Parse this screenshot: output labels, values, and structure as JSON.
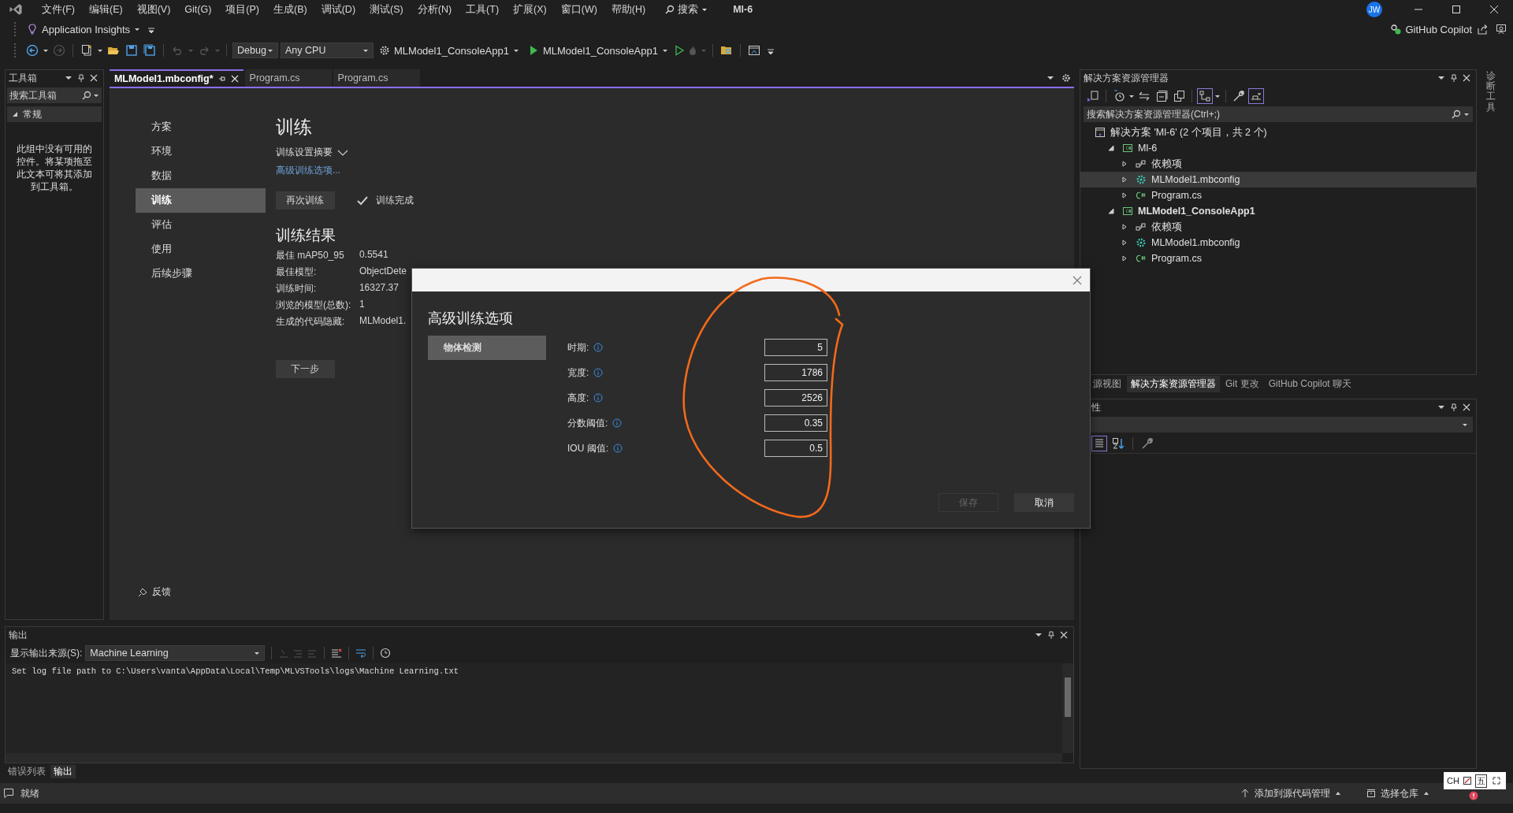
{
  "menu_bar": {
    "items": [
      "文件(F)",
      "编辑(E)",
      "视图(V)",
      "Git(G)",
      "项目(P)",
      "生成(B)",
      "调试(D)",
      "测试(S)",
      "分析(N)",
      "工具(T)",
      "扩展(X)",
      "窗口(W)",
      "帮助(H)"
    ],
    "search": "搜索",
    "solution_name": "Ml-6",
    "avatar": "JW"
  },
  "toolbar": {
    "insights": "Application Insights",
    "configuration": "Debug",
    "platform": "Any CPU",
    "startup_project": "MLModel1_ConsoleApp1",
    "run_target": "MLModel1_ConsoleApp1",
    "copilot": "GitHub Copilot"
  },
  "toolbox": {
    "title": "工具箱",
    "search_placeholder": "搜索工具箱",
    "group": {
      "label": "常规",
      "expanded": true
    },
    "empty_text": "此组中没有可用的控件。将某项拖至此文本可将其添加到工具箱。"
  },
  "editor_tabs": [
    {
      "label": "MLModel1.mbconfig*",
      "selected": true
    },
    {
      "label": "Program.cs",
      "selected": false
    },
    {
      "label": "Program.cs",
      "selected": false
    }
  ],
  "model_builder": {
    "nav": [
      {
        "label": "方案",
        "selected": false
      },
      {
        "label": "环境",
        "selected": false
      },
      {
        "label": "数据",
        "selected": false
      },
      {
        "label": "训练",
        "selected": true
      },
      {
        "label": "评估",
        "selected": false
      },
      {
        "label": "使用",
        "selected": false
      },
      {
        "label": "后续步骤",
        "selected": false
      }
    ],
    "title": "训练",
    "summary_toggle": "训练设置摘要",
    "advanced_link": "高级训练选项...",
    "retrain_button": "再次训练",
    "status": "训练完成",
    "results_title": "训练结果",
    "results": [
      {
        "label": "最佳 mAP50_95",
        "value": "0.5541"
      },
      {
        "label": "最佳模型:",
        "value": "ObjectDete"
      },
      {
        "label": "训练时间:",
        "value": "16327.37"
      },
      {
        "label": "浏览的模型(总数):",
        "value": "1"
      },
      {
        "label": "生成的代码隐藏:",
        "value": "MLModel1."
      }
    ],
    "next_button": "下一步",
    "feedback": "反馈"
  },
  "dialog": {
    "title": "高级训练选项",
    "categories": [
      {
        "label": "物体检测",
        "selected": true
      }
    ],
    "fields": [
      {
        "label": "时期:",
        "value": "5"
      },
      {
        "label": "宽度:",
        "value": "1786"
      },
      {
        "label": "高度:",
        "value": "2526"
      },
      {
        "label": "分数阈值:",
        "value": "0.35"
      },
      {
        "label": "IOU 阈值:",
        "value": "0.5"
      }
    ],
    "save_button": {
      "label": "保存",
      "disabled": true
    },
    "cancel_button": "取消"
  },
  "solution_explorer": {
    "title": "解决方案资源管理器",
    "search_placeholder": "搜索解决方案资源管理器(Ctrl+;)",
    "tree": [
      {
        "label": "解决方案 'Ml-6' (2 个项目，共 2 个)",
        "kind": "solution",
        "selected": false,
        "children": [
          {
            "label": "Ml-6",
            "kind": "project",
            "startup": false,
            "expanded": true,
            "selected": false,
            "children": [
              {
                "label": "依赖项",
                "kind": "dependencies",
                "expanded": false,
                "selected": false
              },
              {
                "label": "MLModel1.mbconfig",
                "kind": "mbconfig",
                "expanded": false,
                "selected": true
              },
              {
                "label": "Program.cs",
                "kind": "csharp",
                "expanded": false,
                "selected": false
              }
            ]
          },
          {
            "label": "MLModel1_ConsoleApp1",
            "kind": "project",
            "startup": true,
            "expanded": true,
            "selected": false,
            "children": [
              {
                "label": "依赖项",
                "kind": "dependencies",
                "expanded": false,
                "selected": false
              },
              {
                "label": "MLModel1.mbconfig",
                "kind": "mbconfig",
                "expanded": false,
                "selected": false
              },
              {
                "label": "Program.cs",
                "kind": "csharp",
                "expanded": false,
                "selected": false
              }
            ]
          }
        ]
      }
    ]
  },
  "right_tabs": [
    {
      "label": "源视图",
      "selected": false
    },
    {
      "label": "解决方案资源管理器",
      "selected": true
    },
    {
      "label": "Git 更改",
      "selected": false
    },
    {
      "label": "GitHub Copilot 聊天",
      "selected": false
    }
  ],
  "properties": {
    "title": "性"
  },
  "side_strip": "诊断工具",
  "output": {
    "title": "输出",
    "source_label": "显示输出来源(S):",
    "source": "Machine Learning",
    "log": "Set log file path to C:\\Users\\vanta\\AppData\\Local\\Temp\\MLVSTools\\logs\\Machine Learning.txt"
  },
  "bottom_tabs": [
    {
      "label": "错误列表",
      "selected": false
    },
    {
      "label": "输出",
      "selected": true
    }
  ],
  "status_bar": {
    "status": "就绪",
    "source_control": "添加到源代码管理",
    "repository": "选择仓库"
  },
  "ime": {
    "language": "CH",
    "mode": "五"
  }
}
